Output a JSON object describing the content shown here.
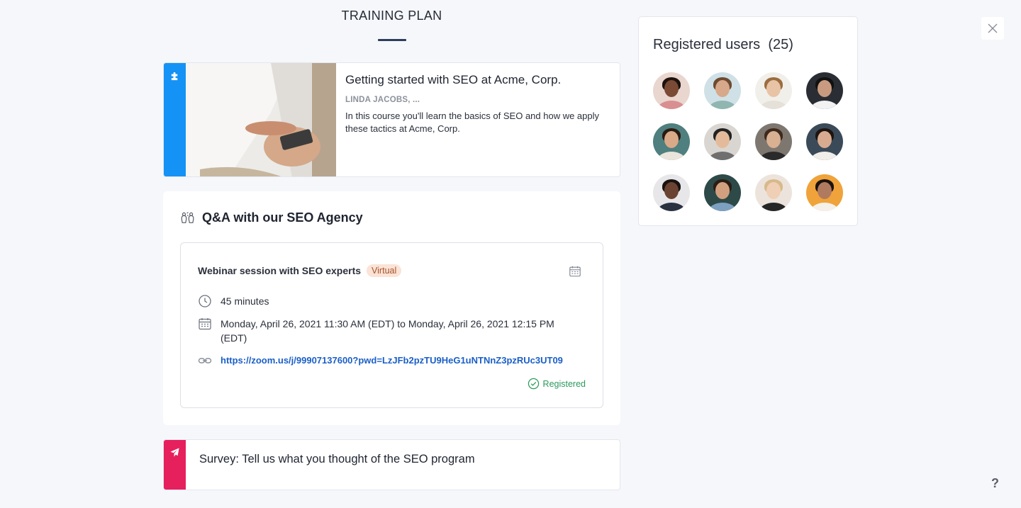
{
  "page": {
    "title": "TRAINING PLAN"
  },
  "course": {
    "title": "Getting started with SEO at Acme, Corp.",
    "authors": "LINDA JACOBS, ...",
    "description": "In this course you'll learn the basics of SEO and how we apply these tactics at Acme, Corp.",
    "stripe_color": "#1592f5",
    "icon": "puzzle-icon"
  },
  "qa": {
    "title": "Q&A with our SEO Agency",
    "icon": "people-icon",
    "session": {
      "title": "Webinar session with SEO experts",
      "badge": "Virtual",
      "duration": "45 minutes",
      "date": "Monday, April 26, 2021 11:30 AM (EDT) to Monday, April 26, 2021 12:15 PM (EDT)",
      "link": "https://zoom.us/j/99907137600?pwd=LzJFb2pzTU9HeG1uNTNnZ3pzRUc3UT09",
      "status": "Registered",
      "status_color": "#2a9a5a",
      "link_color": "#1a5fc7"
    }
  },
  "survey": {
    "title": "Survey: Tell us what you thought of the SEO program",
    "stripe_color": "#e6205d",
    "icon": "send-icon"
  },
  "users": {
    "heading": "Registered users",
    "count": "(25)",
    "avatars": [
      {
        "bg": "#e9d6cf",
        "skin": "#7a4a35",
        "hair": "#1c120d",
        "shirt": "#d98f8f"
      },
      {
        "bg": "#cfe1e6",
        "skin": "#d7a88a",
        "hair": "#6e4a30",
        "shirt": "#8fb6b0"
      },
      {
        "bg": "#f1efea",
        "skin": "#e8c3a6",
        "hair": "#9b6d3e",
        "shirt": "#e5e0d8"
      },
      {
        "bg": "#2a2d33",
        "skin": "#c89b80",
        "hair": "#111111",
        "shirt": "#f2f2f2"
      },
      {
        "bg": "#4f7f7e",
        "skin": "#d9a988",
        "hair": "#2a1b12",
        "shirt": "#eae4dc"
      },
      {
        "bg": "#d9d6d2",
        "skin": "#e4bb9a",
        "hair": "#222222",
        "shirt": "#6f6f6f"
      },
      {
        "bg": "#7e7770",
        "skin": "#d9b091",
        "hair": "#3d2a1c",
        "shirt": "#2a2a2a"
      },
      {
        "bg": "#3a4a58",
        "skin": "#d8ab90",
        "hair": "#1e1510",
        "shirt": "#f1ede8"
      },
      {
        "bg": "#e7e7ea",
        "skin": "#6b4332",
        "hair": "#1a1210",
        "shirt": "#2a3140"
      },
      {
        "bg": "#2d4a48",
        "skin": "#d2a07f",
        "hair": "#2b1d14",
        "shirt": "#7ea0c0"
      },
      {
        "bg": "#ece4dc",
        "skin": "#efcfb6",
        "hair": "#d8b98a",
        "shirt": "#262626"
      },
      {
        "bg": "#efa33a",
        "skin": "#b07a5e",
        "hair": "#1a1210",
        "shirt": "#f5f0ea"
      }
    ]
  }
}
